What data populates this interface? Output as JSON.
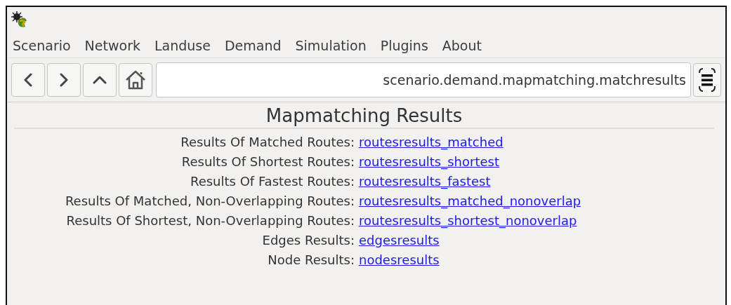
{
  "menu": [
    "Scenario",
    "Network",
    "Landuse",
    "Demand",
    "Simulation",
    "Plugins",
    "About"
  ],
  "toolbar": {
    "buttons": [
      {
        "kind": "back"
      },
      {
        "kind": "forward"
      },
      {
        "kind": "up"
      },
      {
        "kind": "home"
      }
    ],
    "address": "scenario.demand.mapmatching.matchresults"
  },
  "page": {
    "title": "Mapmatching Results",
    "rows": [
      {
        "label": "Results Of Matched Routes:",
        "link": "routesresults_matched"
      },
      {
        "label": "Results Of Shortest Routes:",
        "link": "routesresults_shortest"
      },
      {
        "label": "Results Of Fastest Routes:",
        "link": "routesresults_fastest"
      },
      {
        "label": "Results Of Matched, Non-Overlapping Routes:",
        "link": "routesresults_matched_nonoverlap"
      },
      {
        "label": "Results Of Shortest, Non-Overlapping Routes:",
        "link": "routesresults_shortest_nonoverlap"
      },
      {
        "label": "Edges Results:",
        "link": "edgesresults"
      },
      {
        "label": "Node Results:",
        "link": "nodesresults"
      }
    ]
  }
}
